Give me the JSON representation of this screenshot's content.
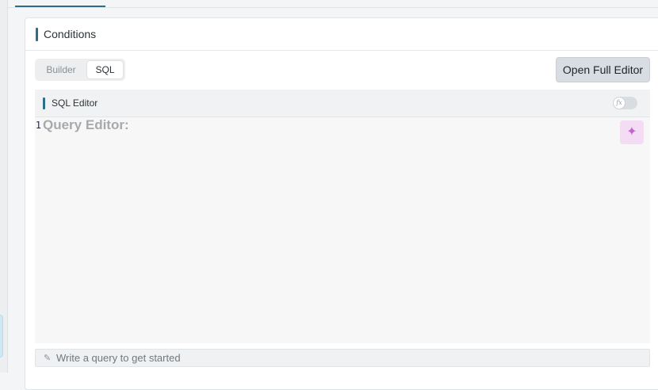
{
  "card": {
    "title": "Conditions"
  },
  "mode_toggle": {
    "builder_label": "Builder",
    "sql_label": "SQL",
    "selected": "SQL"
  },
  "actions": {
    "open_full_editor_label": "Open Full Editor"
  },
  "sql_editor": {
    "title": "SQL Editor",
    "fx_toggle": {
      "icon": "fx",
      "state": "off"
    },
    "line_number": "1",
    "placeholder": "Query Editor:",
    "ai_icon": "sparkle-icon"
  },
  "status_bar": {
    "icon": "pencil-icon",
    "text": "Write a query to get started"
  },
  "colors": {
    "accent": "#2d6e8a",
    "ai_button_bg": "#f3dcf4",
    "ai_icon": "#c266cf"
  }
}
